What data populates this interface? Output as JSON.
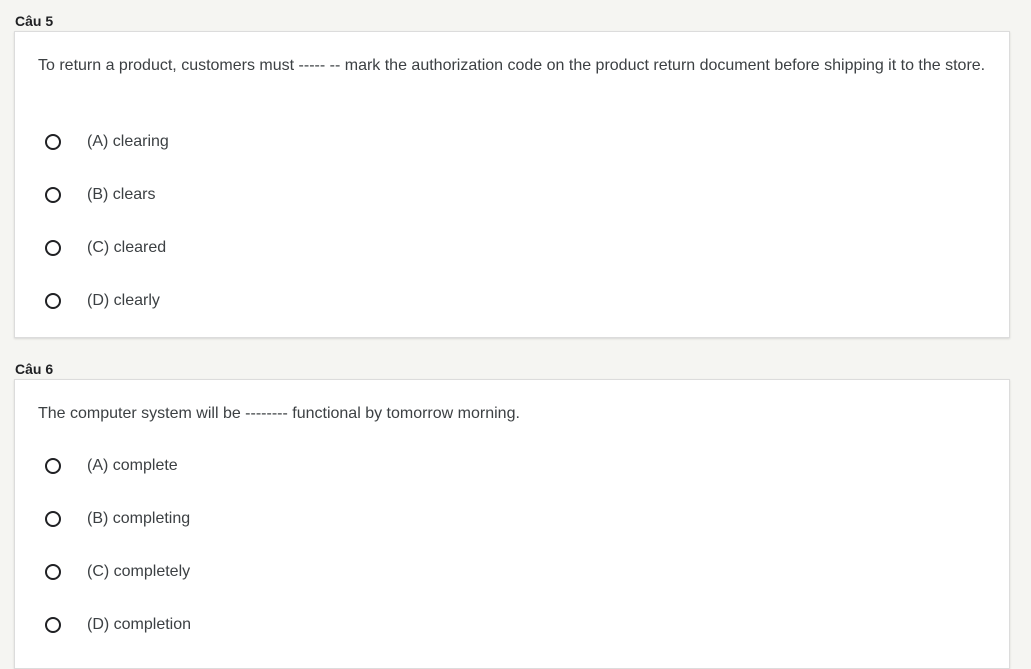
{
  "questions": [
    {
      "label": "Câu 5",
      "text": "To return a product, customers must ----- -- mark the authorization code on the product return document before shipping it to the store.",
      "options": [
        "(A) clearing",
        "(B) clears",
        "(C) cleared",
        "(D) clearly"
      ]
    },
    {
      "label": "Câu 6",
      "text": "The computer system will be -------- functional by tomorrow morning.",
      "options": [
        "(A) complete",
        "(B) completing",
        "(C) completely",
        "(D) completion"
      ]
    }
  ]
}
